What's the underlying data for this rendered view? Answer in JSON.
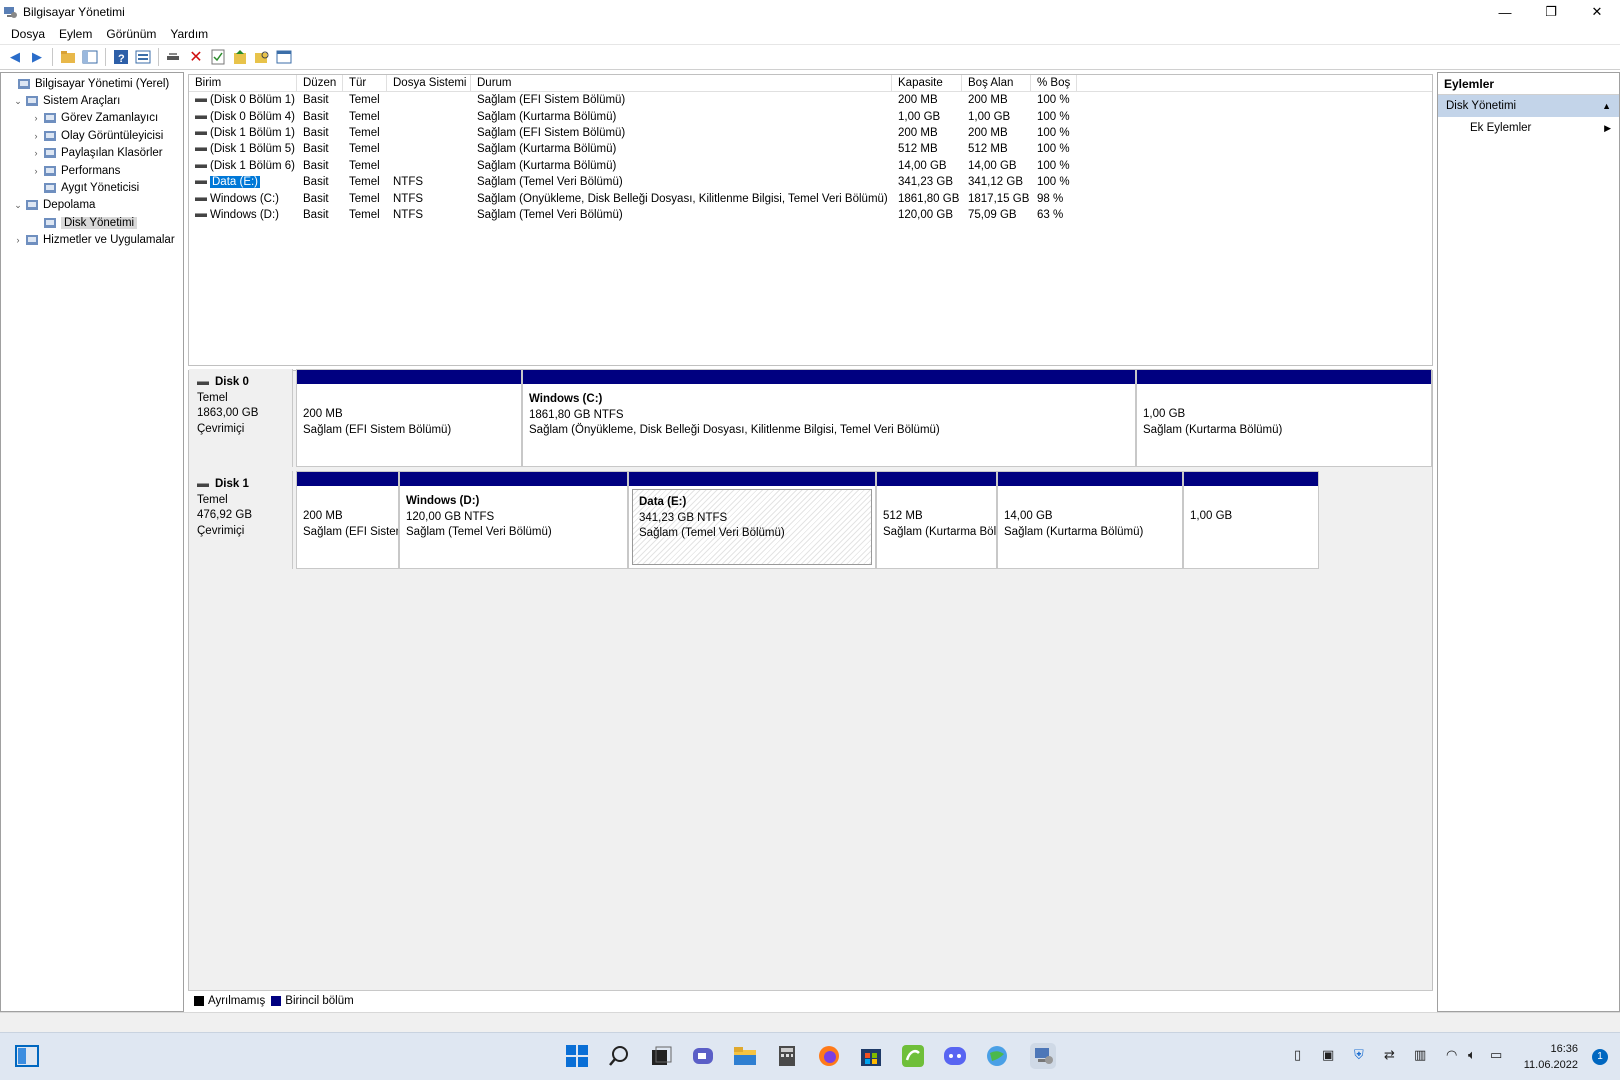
{
  "window": {
    "title": "Bilgisayar Yönetimi"
  },
  "menu": [
    "Dosya",
    "Eylem",
    "Görünüm",
    "Yardım"
  ],
  "tree": [
    {
      "label": "Bilgisayar Yönetimi (Yerel)",
      "icon": "computer-management-icon",
      "chev": ""
    },
    {
      "label": "Sistem Araçları",
      "icon": "tools-icon",
      "chev": "⌄"
    },
    {
      "label": "Görev Zamanlayıcı",
      "icon": "clock-icon",
      "chev": "›"
    },
    {
      "label": "Olay Görüntüleyicisi",
      "icon": "event-viewer-icon",
      "chev": "›"
    },
    {
      "label": "Paylaşılan Klasörler",
      "icon": "shared-folder-icon",
      "chev": "›"
    },
    {
      "label": "Performans",
      "icon": "performance-icon",
      "chev": "›"
    },
    {
      "label": "Aygıt Yöneticisi",
      "icon": "device-manager-icon",
      "chev": ""
    },
    {
      "label": "Depolama",
      "icon": "storage-icon",
      "chev": "⌄"
    },
    {
      "label": "Disk Yönetimi",
      "icon": "disk-icon",
      "chev": ""
    },
    {
      "label": "Hizmetler ve Uygulamalar",
      "icon": "services-icon",
      "chev": "›"
    }
  ],
  "volume_table": {
    "columns": [
      "Birim",
      "Düzen",
      "Tür",
      "Dosya Sistemi",
      "Durum",
      "Kapasite",
      "Boş Alan",
      "% Boş"
    ],
    "rows": [
      [
        "(Disk 0 Bölüm 1)",
        "Basit",
        "Temel",
        "",
        "Sağlam (EFI Sistem Bölümü)",
        "200 MB",
        "200 MB",
        "100 %"
      ],
      [
        "(Disk 0 Bölüm 4)",
        "Basit",
        "Temel",
        "",
        "Sağlam (Kurtarma Bölümü)",
        "1,00 GB",
        "1,00 GB",
        "100 %"
      ],
      [
        "(Disk 1 Bölüm 1)",
        "Basit",
        "Temel",
        "",
        "Sağlam (EFI Sistem Bölümü)",
        "200 MB",
        "200 MB",
        "100 %"
      ],
      [
        "(Disk 1 Bölüm 5)",
        "Basit",
        "Temel",
        "",
        "Sağlam (Kurtarma Bölümü)",
        "512 MB",
        "512 MB",
        "100 %"
      ],
      [
        "(Disk 1 Bölüm 6)",
        "Basit",
        "Temel",
        "",
        "Sağlam (Kurtarma Bölümü)",
        "14,00 GB",
        "14,00 GB",
        "100 %"
      ],
      [
        "Data (E:)",
        "Basit",
        "Temel",
        "NTFS",
        "Sağlam (Temel Veri Bölümü)",
        "341,23 GB",
        "341,12 GB",
        "100 %"
      ],
      [
        "Windows (C:)",
        "Basit",
        "Temel",
        "NTFS",
        "Sağlam (Önyükleme, Disk Belleği Dosyası, Kilitlenme Bilgisi, Temel Veri Bölümü)",
        "1861,80 GB",
        "1817,15 GB",
        "98 %"
      ],
      [
        "Windows (D:)",
        "Basit",
        "Temel",
        "NTFS",
        "Sağlam (Temel Veri Bölümü)",
        "120,00 GB",
        "75,09 GB",
        "63 %"
      ]
    ],
    "selected_row": 5
  },
  "disks": [
    {
      "name": "Disk 0",
      "type": "Temel",
      "size": "1863,00 GB",
      "status": "Çevrimiçi",
      "partitions": [
        {
          "name": "",
          "size": "200 MB",
          "status": "Sağlam (EFI Sistem Bölümü)"
        },
        {
          "name": "Windows  (C:)",
          "size": "1861,80 GB NTFS",
          "status": "Sağlam (Önyükleme, Disk Belleği Dosyası, Kilitlenme Bilgisi, Temel Veri Bölümü)"
        },
        {
          "name": "",
          "size": "1,00 GB",
          "status": "Sağlam (Kurtarma Bölümü)"
        }
      ]
    },
    {
      "name": "Disk 1",
      "type": "Temel",
      "size": "476,92 GB",
      "status": "Çevrimiçi",
      "partitions": [
        {
          "name": "",
          "size": "200 MB",
          "status": "Sağlam (EFI Sistem Bölümü)"
        },
        {
          "name": "Windows  (D:)",
          "size": "120,00 GB NTFS",
          "status": "Sağlam (Temel Veri Bölümü)"
        },
        {
          "name": "Data  (E:)",
          "size": "341,23 GB NTFS",
          "status": "Sağlam (Temel Veri Bölümü)"
        },
        {
          "name": "",
          "size": "512 MB",
          "status": "Sağlam (Kurtarma Bölümü)"
        },
        {
          "name": "",
          "size": "14,00 GB",
          "status": "Sağlam (Kurtarma Bölümü)"
        },
        {
          "name": "",
          "size": "1,00 GB",
          "status": ""
        }
      ]
    }
  ],
  "legend": {
    "unallocated": "Ayrılmamış",
    "primary": "Birincil bölüm",
    "unallocated_color": "#000000",
    "primary_color": "#000080"
  },
  "actions": {
    "title": "Eylemler",
    "section": "Disk Yönetimi",
    "more": "Ek Eylemler"
  },
  "taskbar": {
    "time": "16:36",
    "date": "11.06.2022",
    "notifications": "1"
  }
}
